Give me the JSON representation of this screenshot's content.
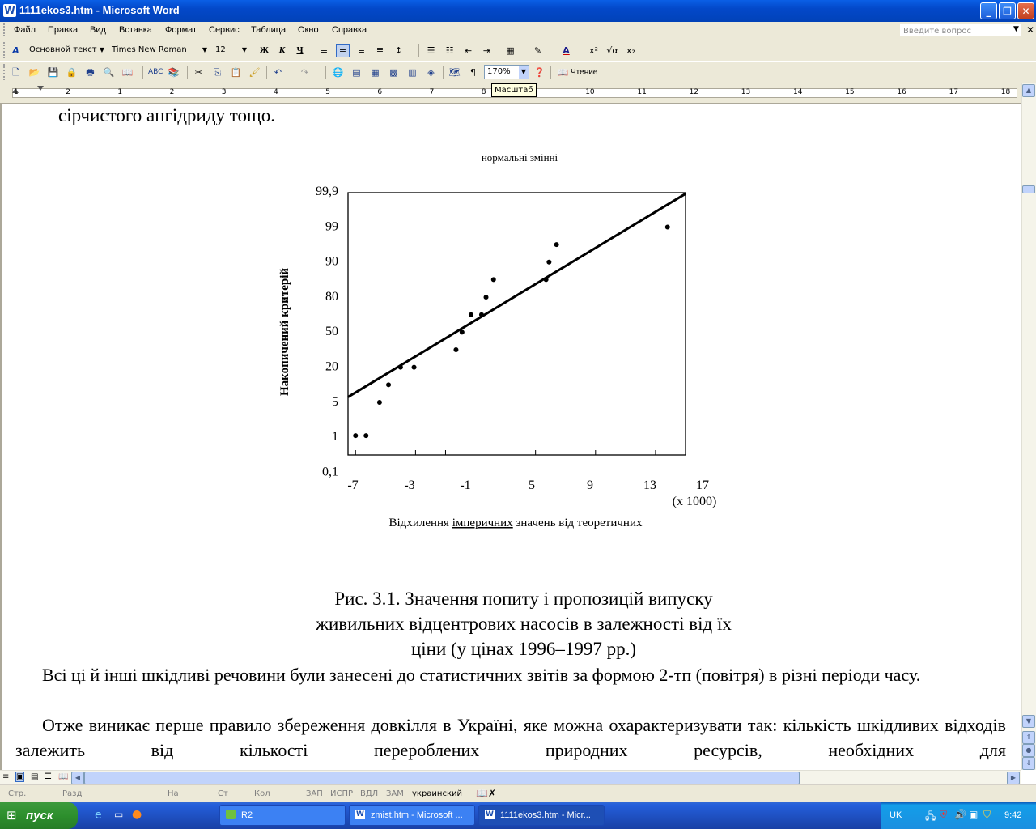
{
  "window": {
    "title": "1111ekos3.htm - Microsoft Word",
    "icon": "word-icon",
    "controls": [
      "minimize-icon",
      "restore-icon",
      "close-icon"
    ]
  },
  "menubar": {
    "items": [
      "Файл",
      "Правка",
      "Вид",
      "Вставка",
      "Формат",
      "Сервис",
      "Таблица",
      "Окно",
      "Справка"
    ],
    "ask_placeholder": "Введите вопрос"
  },
  "format_toolbar": {
    "style": "Основной текст",
    "font": "Times New Roman",
    "size": "12",
    "bold": "Ж",
    "italic": "К",
    "underline": "Ч"
  },
  "standard_toolbar": {
    "zoom": "170%",
    "reading_label": "Чтение",
    "tooltip": "Масштаб"
  },
  "ruler": {
    "numbers": [
      "1",
      "2",
      "1",
      "2",
      "3",
      "4",
      "5",
      "6",
      "7",
      "8",
      "9",
      "10",
      "11",
      "12",
      "13",
      "14",
      "15",
      "16",
      "17",
      "18"
    ]
  },
  "document": {
    "top_line": "сірчистого ангідриду тощо.",
    "caption": [
      "Рис. 3.1. Значення попиту і пропозицій випуску",
      "живильних відцентрових насосів в залежності від їх",
      "ціни (у цінах 1996–1997 рр.)"
    ],
    "para1": "Всі ці й інші шкідливі речовини були занесені до статистичних звітів за формою 2-тп (повітря) в різні періоди часу.",
    "para2": "Отже виникає перше правило збереження довкілля в Україні, яке можна охарактеризувати так: кількість шкідливих відходів залежить від кількості перероблених природних ресурсів, необхідних для"
  },
  "chart_data": {
    "type": "scatter",
    "title": "нормальні змінні",
    "xlabel_parts": [
      "Відхилення ",
      "імперичних",
      " значень від теоретичних"
    ],
    "ylabel": "Накопичений критерій",
    "x_multiplier": "(x 1000)",
    "x_ticks": [
      -7,
      -3,
      -1,
      5,
      9,
      13,
      17
    ],
    "x_tick_labels": [
      "-7",
      "-3",
      "-1",
      "5",
      "9",
      "13",
      "17"
    ],
    "y_tick_labels": [
      "99,9",
      "99",
      "90",
      "80",
      "50",
      "20",
      "5",
      "1",
      "0,1"
    ],
    "xlim": [
      -7.5,
      15
    ],
    "ylim_index": [
      0,
      8
    ],
    "points": [
      {
        "x": -7.0,
        "y_index": 1.0
      },
      {
        "x": -6.3,
        "y_index": 1.0
      },
      {
        "x": -5.4,
        "y_index": 1.95
      },
      {
        "x": -4.8,
        "y_index": 2.45
      },
      {
        "x": -4.0,
        "y_index": 2.95
      },
      {
        "x": -3.1,
        "y_index": 2.95
      },
      {
        "x": -0.3,
        "y_index": 3.45
      },
      {
        "x": 0.1,
        "y_index": 3.95
      },
      {
        "x": 0.7,
        "y_index": 4.45
      },
      {
        "x": 1.4,
        "y_index": 4.45
      },
      {
        "x": 1.7,
        "y_index": 4.95
      },
      {
        "x": 2.2,
        "y_index": 5.45
      },
      {
        "x": 5.7,
        "y_index": 5.45
      },
      {
        "x": 5.9,
        "y_index": 5.95
      },
      {
        "x": 6.4,
        "y_index": 6.45
      },
      {
        "x": 13.8,
        "y_index": 6.95
      }
    ],
    "fit_line": [
      {
        "x": -7.5,
        "y_index": 2.1
      },
      {
        "x": 15,
        "y_index": 7.9
      }
    ]
  },
  "statusbar": {
    "items": [
      "Стр.",
      "Разд",
      "На",
      "Ст",
      "Кол",
      "ЗАП",
      "ИСПР",
      "ВДЛ",
      "ЗАМ",
      "украинский"
    ]
  },
  "taskbar": {
    "start": "пуск",
    "tasks": [
      "R2",
      "zmist.htm - Microsoft ...",
      "1111ekos3.htm - Micr..."
    ],
    "lang": "UK",
    "clock": "9:42"
  }
}
